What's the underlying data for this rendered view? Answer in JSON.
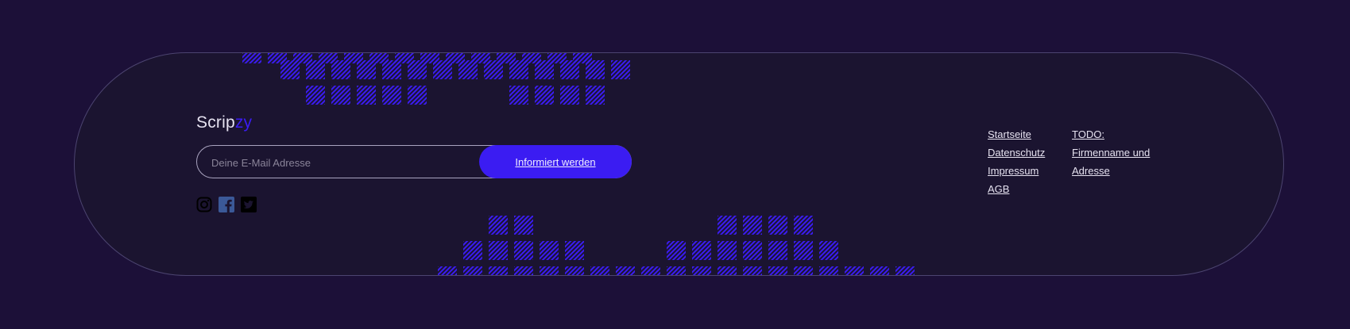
{
  "brand": {
    "name_main": "Scrip",
    "name_accent": "zy"
  },
  "newsletter": {
    "email_placeholder": "Deine E-Mail Adresse",
    "email_value": "",
    "subscribe_label": "Informiert werden"
  },
  "socials": [
    {
      "icon": "instagram-icon"
    },
    {
      "icon": "facebook-icon"
    },
    {
      "icon": "twitter-icon"
    }
  ],
  "nav_links": [
    "Startseite",
    "Datenschutz",
    "Impressum",
    "AGB"
  ],
  "address_links": [
    "TODO:",
    "Firmenname und",
    "Adresse"
  ],
  "colors": {
    "page_background": "#1c1038",
    "card_background": "#1b1430",
    "card_border": "#4c4470",
    "accent": "#3b1cf2",
    "text": "#e6e2f0"
  }
}
